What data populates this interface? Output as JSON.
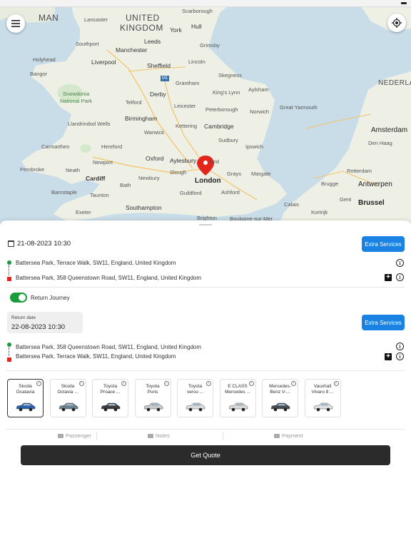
{
  "map": {
    "labels": {
      "isle_of_man": "MAN",
      "uk": "UNITED",
      "kingdom": "KINGDOM",
      "scarborough": "Scarborough",
      "lancaster": "Lancaster",
      "york": "York",
      "hull": "Hull",
      "southport": "Southport",
      "manchester": "Manchester",
      "leeds": "Leeds",
      "grimsby": "Grimsby",
      "liverpool": "Liverpool",
      "sheffield": "Sheffield",
      "holyhead": "Holyhead",
      "lincoln": "Lincoln",
      "bangor": "Bangor",
      "skegness": "Skegness",
      "snowdonia": "Snowdonia",
      "snowdonia2": "National Park",
      "derby": "Derby",
      "grantham": "Grantham",
      "nederland": "NEDERLAND",
      "telford": "Telford",
      "kings_lynn": "King's Lynn",
      "aylsham": "Aylsham",
      "leicester": "Leicester",
      "great_yarmouth": "Great Yarmouth",
      "birmingham": "Birmingham",
      "peterborough": "Peterborough",
      "norwich": "Norwich",
      "llandrindod": "Llandrindod Wells",
      "kettering": "Kettering",
      "amsterdam": "Amsterdam",
      "warwick": "Warwick",
      "cambridge": "Cambridge",
      "sudbury": "Sudbury",
      "carmarthen": "Carmarthen",
      "hereford": "Hereford",
      "ipswich": "Ipswich",
      "den_haag": "Den Haag",
      "oxford": "Oxford",
      "aylesbury": "Aylesbury",
      "pembroke": "Pembroke",
      "newport": "Newport",
      "neath": "Neath",
      "slough": "Slough",
      "watford": "ford",
      "rotterdam": "Rotterdam",
      "cardiff": "Cardiff",
      "newbury": "Newbury",
      "grays": "Grays",
      "margate": "Margate",
      "london": "London",
      "barnstaple": "Barnstaple",
      "bath": "Bath",
      "brugge": "Brugge",
      "antwerpen": "Antwerpen",
      "taunton": "Taunton",
      "guildford": "Guildford",
      "ashford": "Ashford",
      "calais": "Calais",
      "gent": "Gent",
      "southampton": "Southampton",
      "brussel": "Brussel",
      "exeter": "Exeter",
      "brighton": "Brighton",
      "boulogne": "Boulogne-sur-Mer",
      "kortrijk": "Kortrijk",
      "m1": "M1"
    }
  },
  "booking": {
    "pickup_datetime": "21-08-2023 10:30",
    "extra_services_label": "Extra Services",
    "outbound": {
      "from": "Battersea Park, Terrace Walk, SW11, England,  United Kingdom",
      "to": "Battersea Park, 358 Queenstown Road, SW11, England,  United Kingdom"
    },
    "return_toggle_label": "Return Journey",
    "return_toggle_on": true,
    "return_date_caption": "Return date",
    "return_datetime": "22-08-2023 10:30",
    "return": {
      "from": "Battersea Park, 358 Queenstown Road, SW11, England,  United Kingdom",
      "to": "Battersea Park, Terrace Walk, SW11, England,  United Kingdom"
    }
  },
  "vehicles": [
    {
      "name": "Skoda\nOcatavia",
      "color": "#2a5fa8",
      "selected": true
    },
    {
      "name": "Skoda\nOctavia ...",
      "color": "#6b7f8a",
      "selected": false
    },
    {
      "name": "Toyota\nProace ...",
      "color": "#3a3a3a",
      "selected": false
    },
    {
      "name": "Toyota\nPuris",
      "color": "#c8c8c8",
      "selected": false
    },
    {
      "name": "Toyota\nverso ...",
      "color": "#dcdcdc",
      "selected": false
    },
    {
      "name": "E CLASS\nMercedes ...",
      "color": "#d8d8d8",
      "selected": false
    },
    {
      "name": "Mercedes-\nBenz V-...",
      "color": "#444a52",
      "selected": false
    },
    {
      "name": "Vauxhall\nVivaro  8 ...",
      "color": "#e0e0e0",
      "selected": false
    }
  ],
  "tabs": {
    "passenger": "Passenger",
    "notes": "Notes",
    "payment": "Payment"
  },
  "get_quote_label": "Get Quote",
  "colors": {
    "accent": "#1a82e2",
    "toggle_on": "#1a9c3c",
    "pin": "#e2261b",
    "quote_button": "#2b2b2b"
  }
}
